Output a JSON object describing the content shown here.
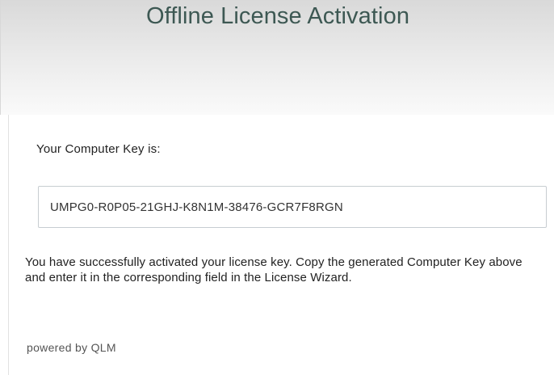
{
  "header": {
    "title": "Offline License Activation"
  },
  "computer_key": {
    "label": "Your Computer Key is:",
    "value": "UMPG0-R0P05-21GHJ-K8N1M-38476-GCR7F8RGN"
  },
  "message": "You have successfully activated your license key. Copy the generated Computer Key above and enter it in the corresponding field in the License Wizard.",
  "footer": {
    "powered_by": "powered by QLM"
  },
  "colors": {
    "title": "#3d5853",
    "field_border": "#c7cdd1"
  }
}
